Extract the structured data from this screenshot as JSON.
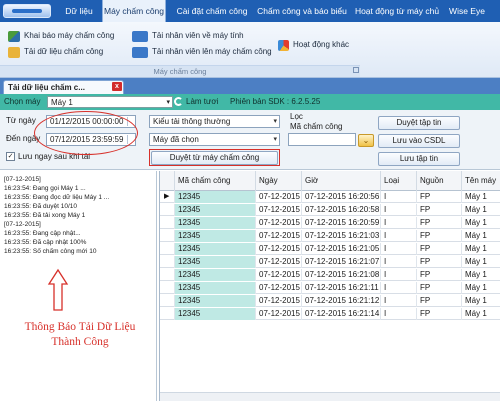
{
  "menu": {
    "items": [
      "Dữ liệu",
      "Máy chấm công",
      "Cài đặt chấm công",
      "Chấm công và báo biểu",
      "Hoạt động từ máy chủ",
      "Wise Eye"
    ],
    "active_index": 1
  },
  "ribbon": {
    "download_data": "Khai báo máy chấm công",
    "download_attendance": "Tải dữ liệu chấm công",
    "download_staff": "Tải nhân viên về máy tính",
    "upload_staff": "Tải nhân viên lên máy chấm công",
    "activity": "Hoạt động khác",
    "group_label": "Máy chấm công"
  },
  "doc_tab": {
    "label": "Tải dữ liệu chấm c...",
    "close": "x"
  },
  "toolbar": {
    "machine_label": "Chọn máy",
    "machine_value": "Máy 1",
    "refresh": "Làm tươi",
    "sdk_version": "Phiên bản SDK : 6.2.5.25"
  },
  "form": {
    "from_label": "Từ ngày",
    "from_value": "01/12/2015 00:00:00",
    "to_label": "Đến ngày",
    "to_value": "07/12/2015 23:59:59",
    "save_after_load_label": "Lưu ngay sau khi tải",
    "save_after_load_checked": true,
    "download_type": "Kiểu tải thông thường",
    "machine_pick": "Máy đã chọn",
    "filter_title": "Lọc",
    "filter_label": "Mã chấm công",
    "filter_value": "",
    "browse_button": "Duyệt từ máy chấm công",
    "browse_file_button": "Duyệt tập tin",
    "save_db_button": "Lưu vào CSDL",
    "save_file_button": "Lưu tập tin"
  },
  "log": {
    "lines": [
      "[07-12-2015]",
      "16:23:54: Đang gọi Máy 1 ...",
      "16:23:55: Đang đọc dữ liệu Máy 1 ...",
      "16:23:55: Đã duyệt 10/10",
      "16:23:55: Đã tải xong Máy 1",
      "[07-12-2015]",
      "16:23:55: Đang cập nhật...",
      "16:23:55: Đã cập nhật 100%",
      "16:23:55: Số chấm công mới 10"
    ],
    "annotation": "Thông Báo Tải Dữ Liệu Thành Công"
  },
  "grid": {
    "columns": [
      "Mã chấm công",
      "Ngày",
      "Giờ",
      "Loại",
      "Nguồn",
      "Tên máy"
    ],
    "rows": [
      [
        "12345",
        "07-12-2015",
        "07-12-2015 16:20:56",
        "I",
        "FP",
        "Máy 1"
      ],
      [
        "12345",
        "07-12-2015",
        "07-12-2015 16:20:58",
        "I",
        "FP",
        "Máy 1"
      ],
      [
        "12345",
        "07-12-2015",
        "07-12-2015 16:20:59",
        "I",
        "FP",
        "Máy 1"
      ],
      [
        "12345",
        "07-12-2015",
        "07-12-2015 16:21:03",
        "I",
        "FP",
        "Máy 1"
      ],
      [
        "12345",
        "07-12-2015",
        "07-12-2015 16:21:05",
        "I",
        "FP",
        "Máy 1"
      ],
      [
        "12345",
        "07-12-2015",
        "07-12-2015 16:21:07",
        "I",
        "FP",
        "Máy 1"
      ],
      [
        "12345",
        "07-12-2015",
        "07-12-2015 16:21:08",
        "I",
        "FP",
        "Máy 1"
      ],
      [
        "12345",
        "07-12-2015",
        "07-12-2015 16:21:11",
        "I",
        "FP",
        "Máy 1"
      ],
      [
        "12345",
        "07-12-2015",
        "07-12-2015 16:21:12",
        "I",
        "FP",
        "Máy 1"
      ],
      [
        "12345",
        "07-12-2015",
        "07-12-2015 16:21:14",
        "I",
        "FP",
        "Máy 1"
      ]
    ],
    "current_row_marker": "▶"
  },
  "colors": {
    "menubar": "#1f5fb3",
    "toolbar": "#41b8a6",
    "first_column": "#bfe9e4",
    "annotation": "#d7302a"
  }
}
